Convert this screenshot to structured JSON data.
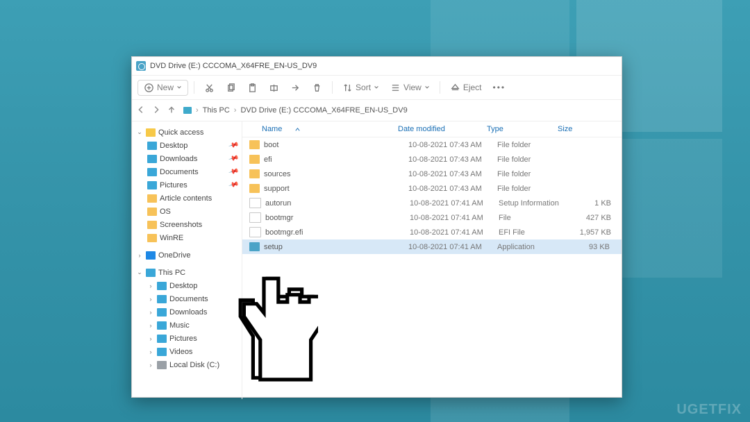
{
  "watermark": "UGETFIX",
  "window": {
    "title": "DVD Drive (E:) CCCOMA_X64FRE_EN-US_DV9"
  },
  "ribbon": {
    "new": "New",
    "sort": "Sort",
    "view": "View",
    "eject": "Eject"
  },
  "breadcrumbs": {
    "root": "This PC",
    "current": "DVD Drive (E:) CCCOMA_X64FRE_EN-US_DV9"
  },
  "tree": {
    "quick_access": "Quick access",
    "qa": {
      "desktop": "Desktop",
      "downloads": "Downloads",
      "documents": "Documents",
      "pictures": "Pictures",
      "article": "Article contents",
      "os": "OS",
      "screenshots": "Screenshots",
      "winre": "WinRE"
    },
    "onedrive": "OneDrive",
    "this_pc": "This PC",
    "pc": {
      "desktop": "Desktop",
      "documents": "Documents",
      "downloads": "Downloads",
      "music": "Music",
      "pictures": "Pictures",
      "videos": "Videos",
      "localdisk": "Local Disk (C:)"
    }
  },
  "columns": {
    "name": "Name",
    "date": "Date modified",
    "type": "Type",
    "size": "Size"
  },
  "files": [
    {
      "name": "boot",
      "date": "10-08-2021 07:43 AM",
      "type": "File folder",
      "size": "",
      "icon": "fol",
      "sel": false
    },
    {
      "name": "efi",
      "date": "10-08-2021 07:43 AM",
      "type": "File folder",
      "size": "",
      "icon": "fol",
      "sel": false
    },
    {
      "name": "sources",
      "date": "10-08-2021 07:43 AM",
      "type": "File folder",
      "size": "",
      "icon": "fol",
      "sel": false
    },
    {
      "name": "support",
      "date": "10-08-2021 07:43 AM",
      "type": "File folder",
      "size": "",
      "icon": "fol",
      "sel": false
    },
    {
      "name": "autorun",
      "date": "10-08-2021 07:41 AM",
      "type": "Setup Information",
      "size": "1 KB",
      "icon": "file",
      "sel": false
    },
    {
      "name": "bootmgr",
      "date": "10-08-2021 07:41 AM",
      "type": "File",
      "size": "427 KB",
      "icon": "file",
      "sel": false
    },
    {
      "name": "bootmgr.efi",
      "date": "10-08-2021 07:41 AM",
      "type": "EFI File",
      "size": "1,957 KB",
      "icon": "file",
      "sel": false
    },
    {
      "name": "setup",
      "date": "10-08-2021 07:41 AM",
      "type": "Application",
      "size": "93 KB",
      "icon": "app",
      "sel": true
    }
  ]
}
